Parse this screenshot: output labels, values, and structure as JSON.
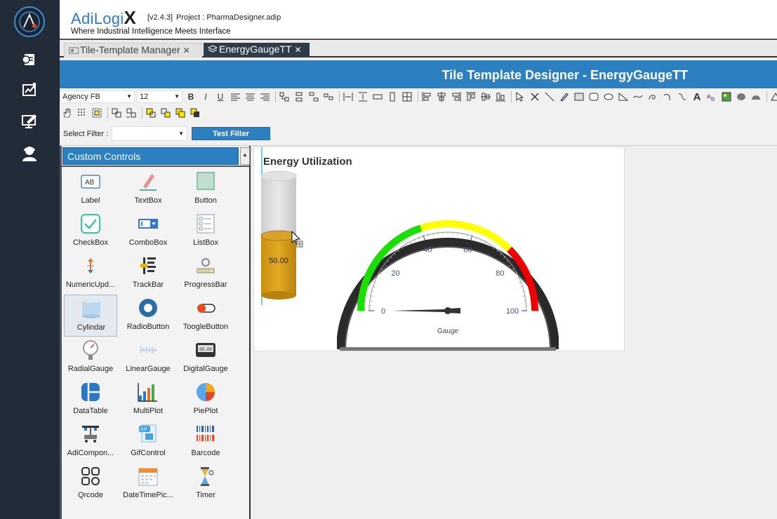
{
  "header": {
    "brand": "AdiLogi",
    "brand_x": "X",
    "version": "[v2.4.3]",
    "project": "Project : PharmaDesigner.adip",
    "tagline": "Where Industrial Intelligence Meets Interface"
  },
  "tabs": [
    {
      "label": "Tile-Template Manager",
      "close": "✕",
      "active": false
    },
    {
      "label": "EnergyGaugeTT",
      "close": "✕",
      "active": true
    }
  ],
  "designer_title": "Tile Template Designer - EnergyGaugeTT",
  "toolbar": {
    "font": "Agency FB",
    "size": "12",
    "bold": "B",
    "italic": "I",
    "underline": "U",
    "text_tool": "A"
  },
  "filter": {
    "label": "Select Filter :",
    "value": "",
    "button": "Test Filter"
  },
  "panel": {
    "title": "Custom Controls",
    "controls": [
      {
        "label": "Label",
        "icon": "label-icon"
      },
      {
        "label": "TextBox",
        "icon": "textbox-icon"
      },
      {
        "label": "Button",
        "icon": "button-icon"
      },
      {
        "label": "CheckBox",
        "icon": "checkbox-icon"
      },
      {
        "label": "ComboBox",
        "icon": "combobox-icon"
      },
      {
        "label": "ListBox",
        "icon": "listbox-icon"
      },
      {
        "label": "NumericUpd...",
        "icon": "numeric-updown-icon"
      },
      {
        "label": "TrackBar",
        "icon": "trackbar-icon"
      },
      {
        "label": "ProgressBar",
        "icon": "progressbar-icon"
      },
      {
        "label": "Cylindar",
        "icon": "cylinder-icon",
        "selected": true
      },
      {
        "label": "RadioButton",
        "icon": "radiobutton-icon"
      },
      {
        "label": "ToogleButton",
        "icon": "toggle-button-icon"
      },
      {
        "label": "RadialGauge",
        "icon": "radial-gauge-icon"
      },
      {
        "label": "LinearGauge",
        "icon": "linear-gauge-icon"
      },
      {
        "label": "DigitalGauge",
        "icon": "digital-gauge-icon"
      },
      {
        "label": "DataTable",
        "icon": "datatable-icon"
      },
      {
        "label": "MultiPlot",
        "icon": "multiplot-icon"
      },
      {
        "label": "PiePlot",
        "icon": "pieplot-icon"
      },
      {
        "label": "AdiCompon...",
        "icon": "adicomponent-icon"
      },
      {
        "label": "GifControl",
        "icon": "gif-icon"
      },
      {
        "label": "Barcode",
        "icon": "barcode-icon"
      },
      {
        "label": "Qrcode",
        "icon": "qrcode-icon"
      },
      {
        "label": "DateTimePic...",
        "icon": "datetime-picker-icon"
      },
      {
        "label": "Timer",
        "icon": "timer-icon"
      }
    ]
  },
  "tile": {
    "title": "Energy Utilization",
    "cylinder_value": "50.00",
    "cylinder_fill": 0.5,
    "gauge": {
      "min": 0,
      "max": 100,
      "value": 0,
      "label": "Gauge",
      "ticks": [
        "0",
        "20",
        "40",
        "60",
        "80",
        "100"
      ],
      "bands": [
        {
          "from": 0,
          "to": 40,
          "color": "#19e000"
        },
        {
          "from": 40,
          "to": 75,
          "color": "#ffff00"
        },
        {
          "from": 75,
          "to": 100,
          "color": "#ee0000"
        }
      ]
    }
  },
  "colors": {
    "accent": "#2d80c0",
    "rail": "#222b38"
  }
}
